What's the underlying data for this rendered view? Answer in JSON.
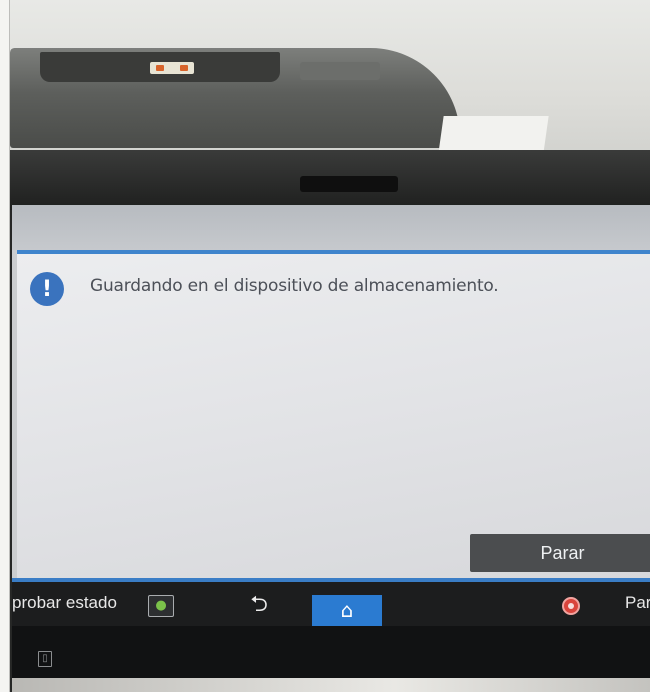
{
  "dialog": {
    "message": "Guardando en el dispositivo de almacenamiento.",
    "info_icon_glyph": "!",
    "info_icon_name": "info-exclamation-icon",
    "stop_button_label": "Parar"
  },
  "bottom_bar": {
    "status_label": "probar estado",
    "status_icon_name": "status-check-icon",
    "back_icon_name": "back-arrow-icon",
    "back_glyph": "⮌",
    "home_icon_name": "home-icon",
    "home_glyph": "⌂",
    "stop_icon_name": "stop-icon",
    "stop_label": "Par"
  },
  "lower_bezel": {
    "card_icon_name": "card-reader-icon"
  },
  "colors": {
    "accent_blue": "#3f84cc",
    "home_button": "#2b7bd1",
    "stop_red": "#d9443c",
    "stop_button": "#4b4d4f"
  }
}
